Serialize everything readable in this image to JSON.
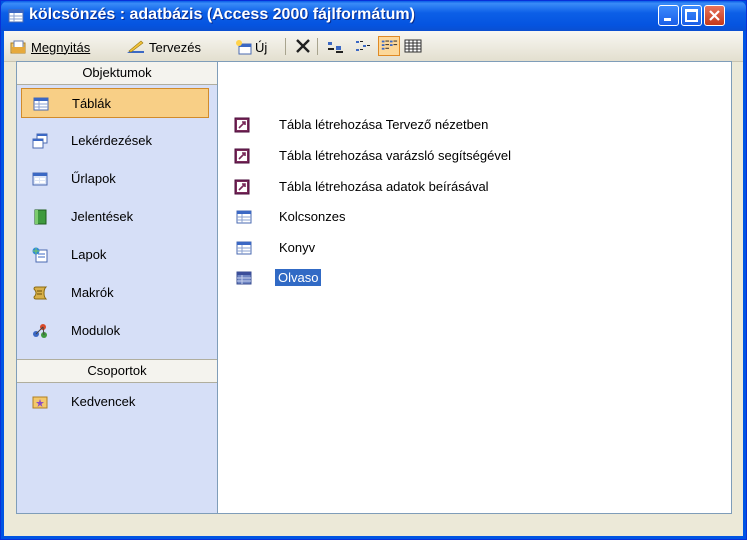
{
  "window": {
    "title": "kölcsönzés : adatbázis (Access 2000 fájlformátum)",
    "title_icon": "database-table-icon"
  },
  "toolbar": {
    "open_label": "Megnyitás",
    "design_label": "Tervezés",
    "new_label": "Új"
  },
  "objects_bar": {
    "objects_header": "Objektumok",
    "groups_header": "Csoportok",
    "items": [
      {
        "label": "Táblák",
        "icon": "table-icon",
        "selected": true
      },
      {
        "label": "Lekérdezések",
        "icon": "query-icon",
        "selected": false
      },
      {
        "label": "Űrlapok",
        "icon": "form-icon",
        "selected": false
      },
      {
        "label": "Jelentések",
        "icon": "report-icon",
        "selected": false
      },
      {
        "label": "Lapok",
        "icon": "page-icon",
        "selected": false
      },
      {
        "label": "Makrók",
        "icon": "macro-icon",
        "selected": false
      },
      {
        "label": "Modulok",
        "icon": "module-icon",
        "selected": false
      }
    ],
    "groups": [
      {
        "label": "Kedvencek",
        "icon": "favorites-folder-icon"
      }
    ]
  },
  "object_list": [
    {
      "label": "Tábla létrehozása Tervező nézetben",
      "icon": "create-shortcut-icon"
    },
    {
      "label": "Tábla létrehozása varázsló segítségével",
      "icon": "create-shortcut-icon"
    },
    {
      "label": "Tábla létrehozása adatok beírásával",
      "icon": "create-shortcut-icon"
    },
    {
      "label": "Kolcsonzes",
      "icon": "table-icon"
    },
    {
      "label": "Konyv",
      "icon": "table-icon"
    },
    {
      "label": "Olvaso",
      "icon": "table-icon",
      "selected": true
    }
  ],
  "colors": {
    "titlebar": "#0054e3",
    "selection": "#316ac5",
    "objbar_bg": "#d6dff7",
    "selected_object": "#f8cf86"
  }
}
